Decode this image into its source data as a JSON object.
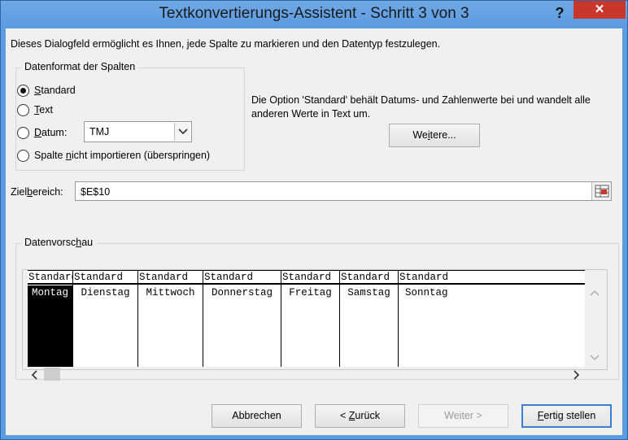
{
  "window": {
    "title": "Textkonvertierungs-Assistent - Schritt 3 von 3",
    "help_glyph": "?",
    "close_glyph": "✕"
  },
  "intro": "Dieses Dialogfeld ermöglicht es Ihnen, jede Spalte zu markieren und den Datentyp festzulegen.",
  "format_group": {
    "title": "Datenformat der Spalten",
    "options": [
      {
        "accel": "S",
        "rest": "tandard",
        "checked": true
      },
      {
        "accel": "T",
        "rest": "ext",
        "checked": false
      },
      {
        "accel": "D",
        "rest": "atum:",
        "checked": false
      },
      {
        "pre": "Spalte ",
        "accel": "n",
        "rest": "icht importieren (überspringen)",
        "checked": false
      }
    ],
    "date_value": "TMJ"
  },
  "description": "Die Option 'Standard' behält Datums- und Zahlenwerte bei und wandelt alle anderen Werte in Text um.",
  "more_button": {
    "pre": "We",
    "accel": "i",
    "rest": "tere..."
  },
  "target": {
    "label_pre": "Ziel",
    "label_accel": "b",
    "label_rest": "ereich:",
    "value": "$E$10"
  },
  "preview_group": {
    "title_pre": "Datenvorsc",
    "title_accel": "h",
    "title_rest": "au",
    "headers": [
      "Standard",
      "Standard",
      "Standard",
      "Standard",
      "Standard",
      "Standard",
      "Standard"
    ],
    "cells": [
      "Montag",
      "Dienstag",
      "Mittwoch",
      "Donnerstag",
      "Freitag",
      "Samstag",
      "Sonntag"
    ],
    "selected_column": 0
  },
  "buttons": {
    "cancel": "Abbrechen",
    "back_pre": "< ",
    "back_accel": "Z",
    "back_rest": "urück",
    "next": "Weiter >",
    "finish_accel": "F",
    "finish_rest": "ertig stellen"
  },
  "colors": {
    "title_bar": "#5b9be0",
    "close": "#c9372c",
    "default_button_border": "#3c7fd1"
  }
}
